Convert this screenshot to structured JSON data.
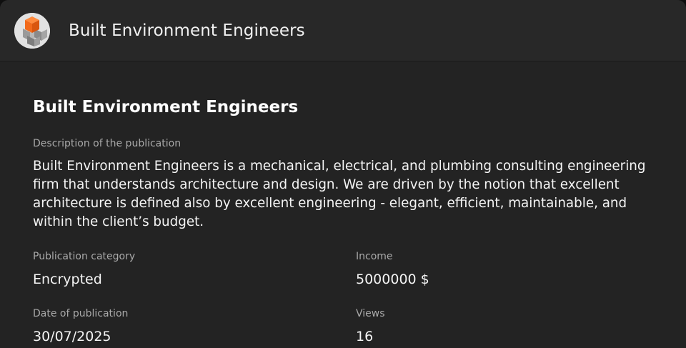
{
  "header": {
    "logo_icon": "cube-logo-icon",
    "title": "Built Environment Engineers"
  },
  "publication": {
    "title": "Built Environment Engineers",
    "description_label": "Description of the publication",
    "description": "Built Environment Engineers is a mechanical, electrical, and plumbing consulting engineering firm that understands architecture and design. We are driven by the notion that excellent architecture is defined also by excellent engineering - elegant, efficient, maintainable, and within the client’s budget.",
    "category_label": "Publication category",
    "category": "Encrypted",
    "income_label": "Income",
    "income": "5000000 $",
    "date_label": "Date of publication",
    "date": "30/07/2025",
    "views_label": "Views",
    "views": "16"
  },
  "colors": {
    "background": "#232323",
    "header_background": "#282828",
    "accent_orange": "#f26a1b",
    "text_primary": "#f4f4f4",
    "text_secondary": "#a9a9a9"
  }
}
